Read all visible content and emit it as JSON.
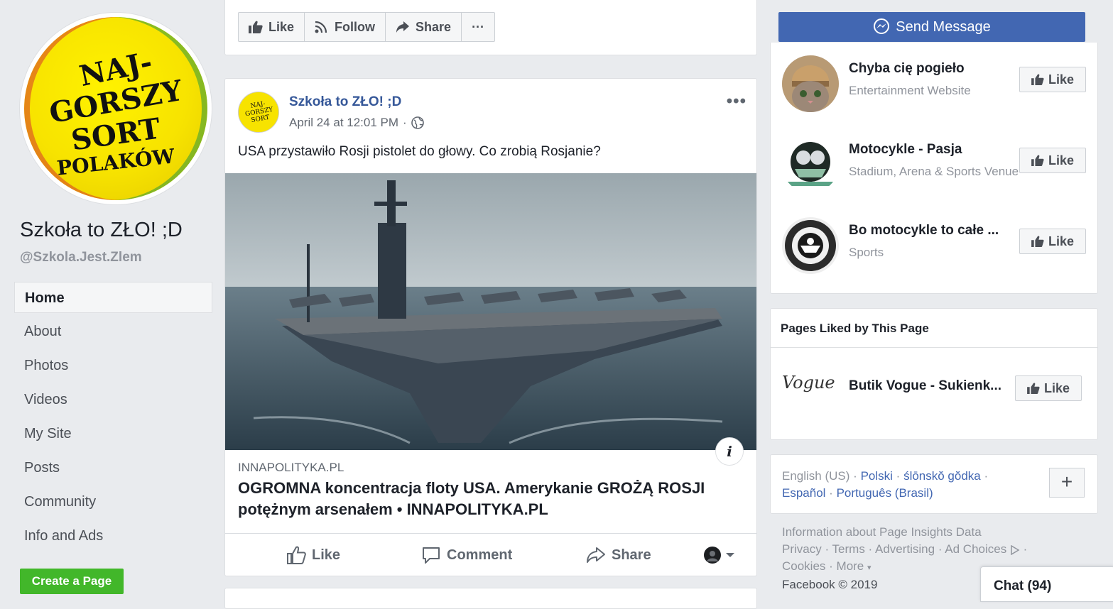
{
  "page": {
    "name": "Szkoła to ZŁO! ;D",
    "handle": "@Szkola.Jest.Zlem",
    "logo_lines": [
      "NAJ-",
      "GORSZY",
      "SORT",
      "POLAKÓW"
    ]
  },
  "nav": {
    "items": [
      "Home",
      "About",
      "Photos",
      "Videos",
      "My Site",
      "Posts",
      "Community",
      "Info and Ads"
    ],
    "active": "Home",
    "create_page": "Create a Page"
  },
  "action_bar": {
    "like": "Like",
    "follow": "Follow",
    "share": "Share",
    "more": "···",
    "send_message": "Send Message"
  },
  "post": {
    "author": "Szkoła to ZŁO! ;D",
    "timestamp": "April 24 at 12:01 PM",
    "separator": "·",
    "more": "•••",
    "text": "USA przystawiło Rosji pistolet do głowy. Co zrobią Rosjanie?",
    "link_domain": "INNAPOLITYKA.PL",
    "link_title": "OGROMNA koncentracja floty USA. Amerykanie GROŻĄ ROSJI potężnym arsenałem • INNAPOLITYKA.PL",
    "info": "i",
    "actions": {
      "like": "Like",
      "comment": "Comment",
      "share": "Share"
    }
  },
  "suggested_pages": [
    {
      "name": "Chyba cię pogieło",
      "category": "Entertainment Website",
      "like": "Like"
    },
    {
      "name": "Motocykle - Pasja",
      "category": "Stadium, Arena & Sports Venue",
      "like": "Like"
    },
    {
      "name": "Bo motocykle to całe ...",
      "category": "Sports",
      "like": "Like"
    }
  ],
  "pages_liked": {
    "heading": "Pages Liked by This Page",
    "items": [
      {
        "name": "Butik Vogue - Sukienk...",
        "logo_text": "Vogue",
        "like": "Like"
      }
    ]
  },
  "languages": {
    "current": "English (US)",
    "others": [
      "Polski",
      "ślōnskŏ gŏdka",
      "Español",
      "Português (Brasil)"
    ],
    "sep": "·",
    "plus": "+"
  },
  "footer": {
    "line1": "Information about Page Insights Data",
    "links": [
      "Privacy",
      "Terms",
      "Advertising",
      "Ad Choices",
      "Cookies",
      "More"
    ],
    "copyright": "Facebook © 2019"
  },
  "chat": {
    "label": "Chat (94)"
  },
  "colors": {
    "fb_blue": "#4267b2",
    "link_blue": "#365899",
    "green": "#42b72a",
    "bg": "#e9ebee",
    "logo_yellow": "#f7e300"
  },
  "icons": [
    "thumbs-up-icon",
    "rss-icon",
    "share-arrow-icon",
    "messenger-icon",
    "globe-icon",
    "comment-icon",
    "caret-down-icon",
    "info-icon",
    "plus-icon"
  ]
}
